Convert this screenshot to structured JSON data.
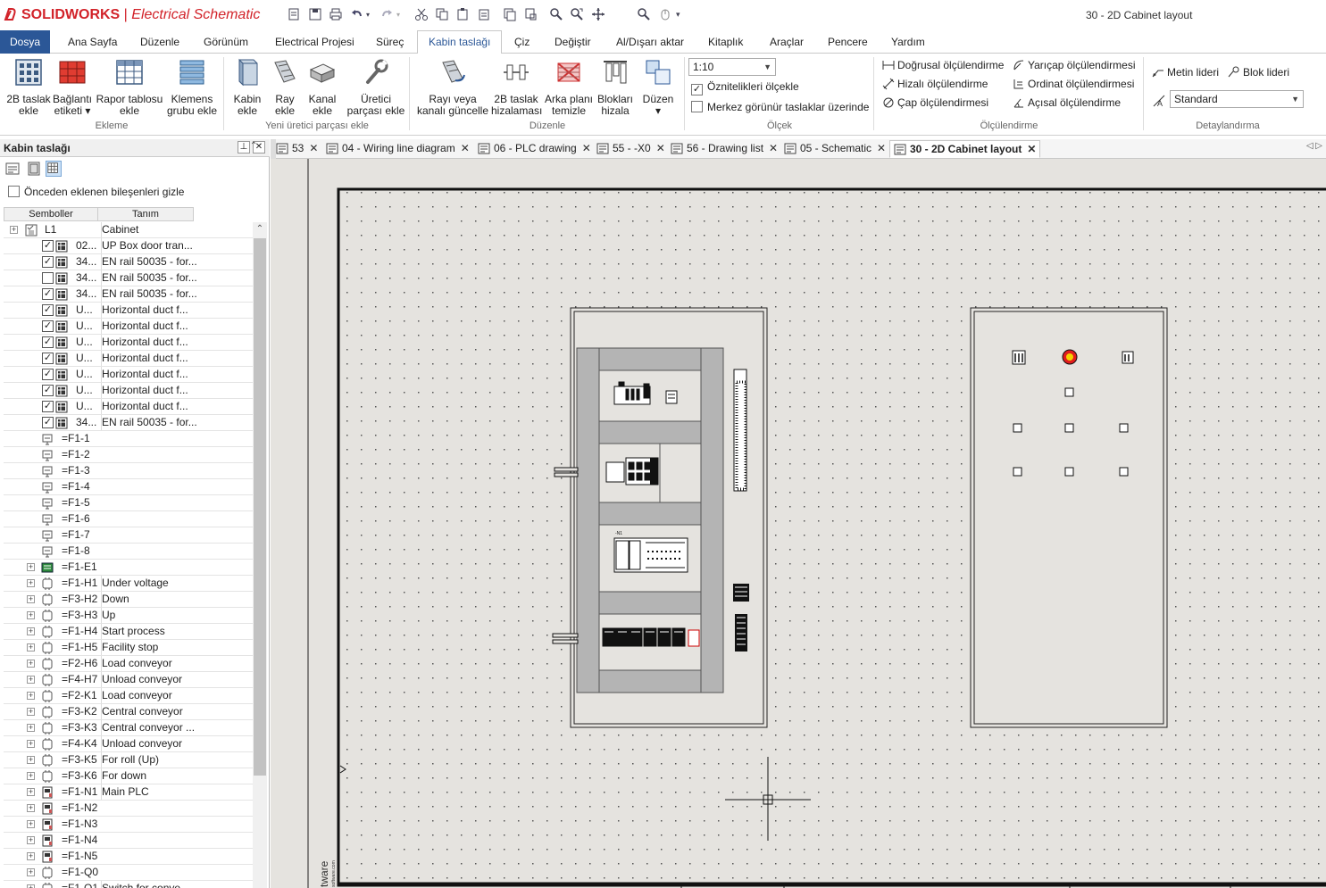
{
  "app": {
    "brand": "SOLIDWORKS",
    "product": "Electrical Schematic",
    "document_title": "30 - 2D Cabinet layout"
  },
  "menu": {
    "items": [
      "Dosya",
      "Ana Sayfa",
      "Düzenle",
      "Görünüm",
      "Electrical Projesi",
      "Süreç",
      "Kabin taslağı",
      "Çiz",
      "Değiştir",
      "Al/Dışarı aktar",
      "Kitaplık",
      "Araçlar",
      "Pencere",
      "Yardım"
    ],
    "active": "Kabin taslağı"
  },
  "ribbon": {
    "ekleme": {
      "group": "Ekleme",
      "buttons": [
        {
          "l1": "2B taslak",
          "l2": "ekle"
        },
        {
          "l1": "Bağlantı",
          "l2": "etiketi ▾"
        },
        {
          "l1": "Rapor tablosu",
          "l2": "ekle"
        },
        {
          "l1": "Klemens",
          "l2": "grubu ekle"
        }
      ]
    },
    "uretici": {
      "group": "Yeni üretici parçası ekle",
      "buttons": [
        {
          "l1": "Kabin",
          "l2": "ekle"
        },
        {
          "l1": "Ray",
          "l2": "ekle"
        },
        {
          "l1": "Kanal",
          "l2": "ekle"
        },
        {
          "l1": "Üretici",
          "l2": "parçası ekle"
        }
      ]
    },
    "duzenle": {
      "group": "Düzenle",
      "buttons": [
        {
          "l1": "Rayı veya",
          "l2": "kanalı güncelle"
        },
        {
          "l1": "2B taslak",
          "l2": "hizalaması"
        },
        {
          "l1": "Arka planı",
          "l2": "temizle"
        },
        {
          "l1": "Blokları",
          "l2": "hizala"
        },
        {
          "l1": "Düzen",
          "l2": "▾"
        }
      ]
    },
    "olcek": {
      "group": "Ölçek",
      "scale": "1:10",
      "scale_attrs": "Öznitelikleri ölçekle",
      "scale_attrs_checked": true,
      "center_view": "Merkez görünür taslaklar üzerinde",
      "center_view_checked": false
    },
    "olculendirme": {
      "group": "Ölçülendirme",
      "items": [
        "Doğrusal ölçülendirme",
        "Hizalı ölçülendirme",
        "Çap ölçülendirmesi",
        "Yarıçap ölçülendirmesi",
        "Ordinat ölçülendirmesi",
        "Açısal ölçülendirme"
      ]
    },
    "detay": {
      "group": "Detaylandırma",
      "text_leader": "Metin lideri",
      "block_leader": "Blok lideri",
      "style": "Standard"
    }
  },
  "panel": {
    "title": "Kabin taslağı",
    "hide_label": "Önceden eklenen bileşenleri gizle",
    "col_symbols": "Semboller",
    "col_description": "Tanım",
    "rows": [
      {
        "sym": "L1",
        "desc": "Cabinet",
        "level": 0,
        "cb": "none",
        "icon": "cabinet-icon",
        "exp": "+"
      },
      {
        "sym": "02...",
        "desc": "UP Box door tran...",
        "level": 1,
        "cb": "checked",
        "icon": "component-icon"
      },
      {
        "sym": "34...",
        "desc": "EN rail 50035 - for...",
        "level": 1,
        "cb": "checked",
        "icon": "component-icon"
      },
      {
        "sym": "34...",
        "desc": "EN rail 50035 - for...",
        "level": 1,
        "cb": "unchecked",
        "icon": "component-icon"
      },
      {
        "sym": "34...",
        "desc": "EN rail 50035 - for...",
        "level": 1,
        "cb": "checked",
        "icon": "component-icon"
      },
      {
        "sym": "U...",
        "desc": "Horizontal duct f...",
        "level": 1,
        "cb": "checked",
        "icon": "component-icon"
      },
      {
        "sym": "U...",
        "desc": "Horizontal duct f...",
        "level": 1,
        "cb": "checked",
        "icon": "component-icon"
      },
      {
        "sym": "U...",
        "desc": "Horizontal duct f...",
        "level": 1,
        "cb": "checked",
        "icon": "component-icon"
      },
      {
        "sym": "U...",
        "desc": "Horizontal duct f...",
        "level": 1,
        "cb": "checked",
        "icon": "component-icon"
      },
      {
        "sym": "U...",
        "desc": "Horizontal duct f...",
        "level": 1,
        "cb": "checked",
        "icon": "component-icon"
      },
      {
        "sym": "U...",
        "desc": "Horizontal duct f...",
        "level": 1,
        "cb": "checked",
        "icon": "component-icon"
      },
      {
        "sym": "U...",
        "desc": "Horizontal duct f...",
        "level": 1,
        "cb": "checked",
        "icon": "component-icon"
      },
      {
        "sym": "34...",
        "desc": "EN rail 50035 - for...",
        "level": 1,
        "cb": "checked",
        "icon": "component-icon"
      },
      {
        "sym": "=F1-1",
        "desc": "",
        "level": 2,
        "icon": "breaker-icon"
      },
      {
        "sym": "=F1-2",
        "desc": "",
        "level": 2,
        "icon": "breaker-icon"
      },
      {
        "sym": "=F1-3",
        "desc": "",
        "level": 2,
        "icon": "breaker-icon"
      },
      {
        "sym": "=F1-4",
        "desc": "",
        "level": 2,
        "icon": "breaker-icon"
      },
      {
        "sym": "=F1-5",
        "desc": "",
        "level": 2,
        "icon": "breaker-icon"
      },
      {
        "sym": "=F1-6",
        "desc": "",
        "level": 2,
        "icon": "breaker-icon"
      },
      {
        "sym": "=F1-7",
        "desc": "",
        "level": 2,
        "icon": "breaker-icon"
      },
      {
        "sym": "=F1-8",
        "desc": "",
        "level": 2,
        "icon": "breaker-icon"
      },
      {
        "sym": "=F1-E1",
        "desc": "",
        "level": 2,
        "icon": "plc-green-icon",
        "exp": "+"
      },
      {
        "sym": "=F1-H1",
        "desc": "Under voltage",
        "level": 2,
        "icon": "part-icon",
        "exp": "+"
      },
      {
        "sym": "=F3-H2",
        "desc": "Down",
        "level": 2,
        "icon": "part-icon",
        "exp": "+"
      },
      {
        "sym": "=F3-H3",
        "desc": "Up",
        "level": 2,
        "icon": "part-icon",
        "exp": "+"
      },
      {
        "sym": "=F1-H4",
        "desc": "Start process",
        "level": 2,
        "icon": "part-icon",
        "exp": "+"
      },
      {
        "sym": "=F1-H5",
        "desc": "Facility stop",
        "level": 2,
        "icon": "part-icon",
        "exp": "+"
      },
      {
        "sym": "=F2-H6",
        "desc": "Load conveyor",
        "level": 2,
        "icon": "part-icon",
        "exp": "+"
      },
      {
        "sym": "=F4-H7",
        "desc": "Unload conveyor",
        "level": 2,
        "icon": "part-icon",
        "exp": "+"
      },
      {
        "sym": "=F2-K1",
        "desc": "Load conveyor",
        "level": 2,
        "icon": "part-icon",
        "exp": "+"
      },
      {
        "sym": "=F3-K2",
        "desc": "Central conveyor",
        "level": 2,
        "icon": "part-icon",
        "exp": "+"
      },
      {
        "sym": "=F3-K3",
        "desc": "Central conveyor ...",
        "level": 2,
        "icon": "part-icon",
        "exp": "+"
      },
      {
        "sym": "=F4-K4",
        "desc": "Unload conveyor",
        "level": 2,
        "icon": "part-icon",
        "exp": "+"
      },
      {
        "sym": "=F3-K5",
        "desc": "For roll (Up)",
        "level": 2,
        "icon": "part-icon",
        "exp": "+"
      },
      {
        "sym": "=F3-K6",
        "desc": "For down",
        "level": 2,
        "icon": "part-icon",
        "exp": "+"
      },
      {
        "sym": "=F1-N1",
        "desc": "Main PLC",
        "level": 2,
        "icon": "plc-icon",
        "exp": "+"
      },
      {
        "sym": "=F1-N2",
        "desc": "",
        "level": 2,
        "icon": "plc-icon",
        "exp": "+"
      },
      {
        "sym": "=F1-N3",
        "desc": "",
        "level": 2,
        "icon": "plc-icon",
        "exp": "+"
      },
      {
        "sym": "=F1-N4",
        "desc": "",
        "level": 2,
        "icon": "plc-icon",
        "exp": "+"
      },
      {
        "sym": "=F1-N5",
        "desc": "",
        "level": 2,
        "icon": "plc-icon",
        "exp": "+"
      },
      {
        "sym": "=F1-Q0",
        "desc": "",
        "level": 2,
        "icon": "part-icon",
        "exp": "+"
      },
      {
        "sym": "=F1-Q1",
        "desc": "Switch for conve...",
        "level": 2,
        "icon": "part-icon",
        "exp": "+"
      }
    ]
  },
  "doc_tabs": [
    {
      "label": "53",
      "icon": "schematic-tab-icon",
      "active": false
    },
    {
      "label": "04 - Wiring line diagram",
      "icon": "wiring-tab-icon",
      "active": false
    },
    {
      "label": "06 - PLC drawing",
      "icon": "schematic-tab-icon",
      "active": false
    },
    {
      "label": "55 - -X0",
      "icon": "terminal-tab-icon",
      "active": false
    },
    {
      "label": "56 - Drawing list",
      "icon": "list-tab-icon",
      "active": false
    },
    {
      "label": "05 - Schematic",
      "icon": "schematic-tab-icon",
      "active": false
    },
    {
      "label": "30 - 2D Cabinet layout",
      "icon": "cabinet-tab-icon",
      "active": true
    }
  ],
  "canvas": {
    "watermark": "tware",
    "watermark_small": "software.com",
    "plc_label": "-N1"
  },
  "colors": {
    "file_menu": "#2b5797",
    "canvas_bg": "#e5e3df",
    "brand_red": "#d2232a",
    "panel_gray": "#b4b4b4"
  }
}
